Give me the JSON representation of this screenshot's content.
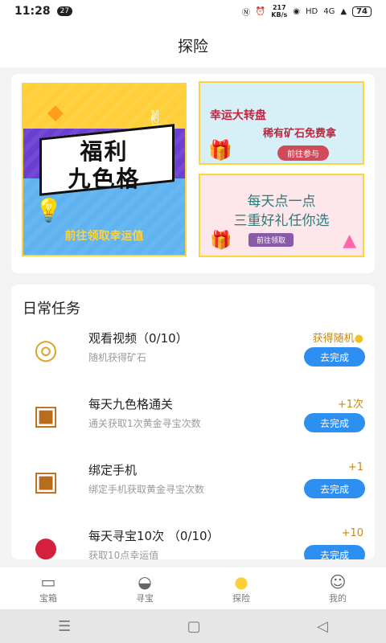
{
  "statusbar": {
    "time": "11:28",
    "notif_count": "27",
    "speed_value": "217",
    "speed_unit": "KB/s",
    "network": "4G",
    "battery": "74"
  },
  "header": {
    "title": "探险"
  },
  "banners": {
    "big": {
      "line1": "福利",
      "line2": "九色格",
      "footer": "前往领取幸运值"
    },
    "small1": {
      "line1": "幸运大转盘",
      "line2": "稀有矿石免费拿",
      "button": "前往参与"
    },
    "small2": {
      "line1": "每天点一点",
      "line2": "三重好礼任你选",
      "button": "前往领取"
    }
  },
  "tasks": {
    "heading": "日常任务",
    "items": [
      {
        "title": "观看视频（0/10）",
        "subtitle": "随机获得矿石",
        "reward": "获得随机",
        "button": "去完成",
        "icon": "gold-coins-icon"
      },
      {
        "title": "每天九色格通关",
        "subtitle": "通关获取1次黄金寻宝次数",
        "reward": "+1次",
        "button": "去完成",
        "icon": "treasure-chest-icon"
      },
      {
        "title": "绑定手机",
        "subtitle": "绑定手机获取黄金寻宝次数",
        "reward": "+1",
        "button": "去完成",
        "icon": "treasure-chest-icon"
      },
      {
        "title": "每天寻宝10次 （0/10）",
        "subtitle": "获取10点幸运值",
        "reward": "+10",
        "button": "去完成",
        "icon": "potion-icon"
      }
    ]
  },
  "tabbar": {
    "items": [
      {
        "label": "宝箱",
        "icon": "chest-icon"
      },
      {
        "label": "寻宝",
        "icon": "ingot-icon"
      },
      {
        "label": "探险",
        "icon": "planet-icon",
        "active": true
      },
      {
        "label": "我的",
        "icon": "profile-icon"
      }
    ]
  },
  "colors": {
    "accent": "#2d8ff0",
    "reward": "#c68a16",
    "active_tab": "#ffcf3a"
  }
}
